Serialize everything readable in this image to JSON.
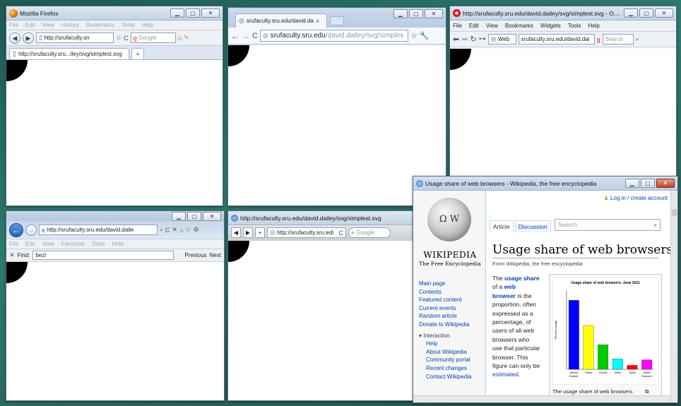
{
  "firefox": {
    "title": "Mozilla Firefox",
    "menu": [
      "File",
      "Edit",
      "View",
      "History",
      "Bookmarks",
      "Tools",
      "Help"
    ],
    "url": "http://srufaculty.sn",
    "search_placeholder": "Google",
    "tab_label": "http://srufaculty.sru...iley/svg/simplest.svg"
  },
  "chrome": {
    "tab_label": "srufaculty.sru.edu/david.da",
    "url_host": "srufaculty.sru.edu",
    "url_path": "/david.dailey/svg/simples"
  },
  "opera": {
    "title": "http://srufaculty.sru.edu/david.dailey/svg/simplest.svg - Opera",
    "menu": [
      "File",
      "Edit",
      "View",
      "Bookmarks",
      "Widgets",
      "Tools",
      "Help"
    ],
    "web_label": "Web",
    "url": "srufaculty.sru.edu/david.dai",
    "search_placeholder": "Search"
  },
  "ie": {
    "url": "http://srufaculty.sru.edu/david.daile",
    "menu": [
      "File",
      "Edit",
      "View",
      "Favorites",
      "Tools",
      "Help"
    ],
    "find_label": "Find:",
    "find_value": "bezi",
    "previous": "Previous",
    "next": "Next"
  },
  "safari": {
    "title": "http://srufaculty.sru.edu/david.dailey/svg/simplest.svg",
    "url": "http://srufaculty.sru.edi",
    "search_placeholder": "Google"
  },
  "wikipedia": {
    "window_title": "Usage share of web browsers - Wikipedia, the free encyclopedia",
    "login": "Log in / create account",
    "wordmark": "WIKIPEDIA",
    "tagline": "The Free Encyclopedia",
    "tab_article": "Article",
    "tab_discussion": "Discussion",
    "search_placeholder": "Search",
    "page_title": "Usage share of web browsers",
    "from": "From Wikipedia, the free encyclopedia",
    "para": {
      "t1": "The ",
      "l1": "usage share",
      "t2": " of a ",
      "l2": "web browser",
      "t3": " is the proportion, often expressed as a percentage, of users of all web browsers who use that particular browser. This figure can only be ",
      "l3": "estimated",
      "t4": "."
    },
    "nav": [
      "Main page",
      "Contents",
      "Featured content",
      "Current events",
      "Random article",
      "Donate to Wikipedia"
    ],
    "nav_section": "Interaction",
    "nav_sub": [
      "Help",
      "About Wikipedia",
      "Community portal",
      "Recent changes",
      "Contact Wikipedia"
    ],
    "caption": "The usage share of web browsers."
  },
  "chart_data": {
    "type": "bar",
    "title": "Usage share of web browsers: June 2011",
    "ylabel": "Percent Usage",
    "categories": [
      "Internet Explorer",
      "Firefox",
      "Chrome",
      "Safari",
      "Opera",
      "Mobile Browsers"
    ],
    "values": [
      43.6,
      27.7,
      15.5,
      6.6,
      2.5,
      6.0
    ],
    "colors": [
      "#0000ff",
      "#ffff00",
      "#00cc00",
      "#00ffff",
      "#ff0000",
      "#ff00ff"
    ],
    "ylim": [
      0,
      50
    ],
    "grid": false
  }
}
